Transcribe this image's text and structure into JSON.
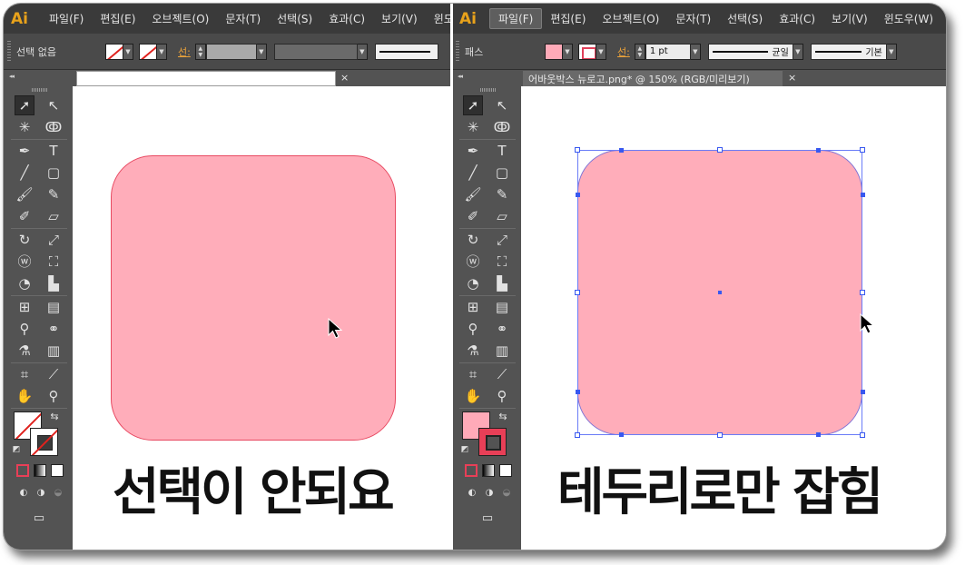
{
  "app": {
    "logo": "Ai",
    "accent_color": "#e8a21b"
  },
  "left": {
    "menu": [
      "파일(F)",
      "편집(E)",
      "오브젝트(O)",
      "문자(T)",
      "선택(S)",
      "효과(C)",
      "보기(V)",
      "윈도"
    ],
    "control": {
      "selection_label": "선택 없음",
      "stroke_label": "선:"
    },
    "tab": {
      "title": "",
      "close": "×"
    },
    "caption": "선택이 안되요",
    "shape": {
      "fill": "#ffadba",
      "stroke": "#e84a62"
    }
  },
  "right": {
    "menu": [
      "파일(F)",
      "편집(E)",
      "오브젝트(O)",
      "문자(T)",
      "선택(S)",
      "효과(C)",
      "보기(V)",
      "윈도우(W)"
    ],
    "active_menu": "파일(F)",
    "control": {
      "selection_label": "패스",
      "stroke_label": "선:",
      "stroke_weight": "1 pt",
      "profile": "균일",
      "brush": "기본"
    },
    "tab": {
      "title": "어바웃박스 뉴로고.png* @ 150% (RGB/미리보기)",
      "close": "×"
    },
    "caption": "테두리로만 잡힘",
    "shape": {
      "fill": "#ffadba",
      "stroke": "#7f73d6"
    }
  },
  "toolbox": {
    "grip": "◂◂",
    "icons": [
      "selection-tool-icon",
      "direct-selection-tool-icon",
      "magic-wand-tool-icon",
      "lasso-tool-icon",
      "pen-tool-icon",
      "type-tool-icon",
      "line-tool-icon",
      "rounded-rectangle-tool-icon",
      "paintbrush-tool-icon",
      "pencil-tool-icon",
      "blob-brush-tool-icon",
      "eraser-tool-icon",
      "rotate-tool-icon",
      "scale-tool-icon",
      "warp-tool-icon",
      "free-transform-tool-icon",
      "shape-builder-tool-icon",
      "graph-tool-icon",
      "mesh-tool-icon",
      "gradient-tool-icon",
      "eyedropper-tool-icon",
      "blend-tool-icon",
      "symbol-sprayer-tool-icon",
      "column-graph-tool-icon",
      "artboard-tool-icon",
      "slice-tool-icon",
      "hand-tool-icon",
      "zoom-tool-icon"
    ]
  }
}
